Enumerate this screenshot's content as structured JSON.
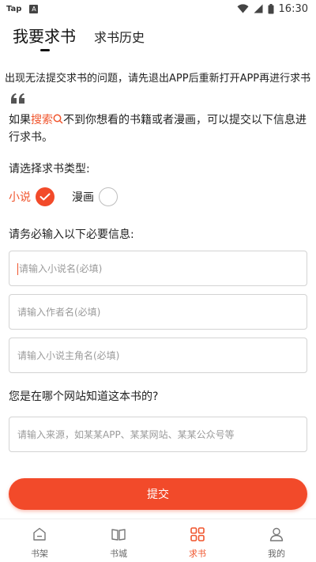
{
  "status_bar": {
    "app_label": "Tap",
    "notif_letter": "A",
    "time": "16:30",
    "icons": [
      "wifi-icon",
      "signal-icon",
      "battery-icon"
    ]
  },
  "header": {
    "tabs": [
      {
        "label": "我要求书",
        "active": true
      },
      {
        "label": "求书历史",
        "active": false
      }
    ]
  },
  "notice": {
    "text": "出现无法提交求书的问题，请先退出APP后重新打开APP再进行求书"
  },
  "hint": {
    "prefix": "如果",
    "search_label": "搜索",
    "suffix": "不到你想看的书籍或者漫画，可以提交以下信息进行求书。"
  },
  "type_section": {
    "label": "请选择求书类型:",
    "options": [
      {
        "label": "小说",
        "selected": true
      },
      {
        "label": "漫画",
        "selected": false
      }
    ]
  },
  "required_section": {
    "label": "请务必输入以下必要信息:",
    "fields": [
      {
        "placeholder": "请输入小说名(必填)",
        "value": ""
      },
      {
        "placeholder": "请输入作者名(必填)",
        "value": ""
      },
      {
        "placeholder": "请输入小说主角名(必填)",
        "value": ""
      }
    ]
  },
  "source_section": {
    "label": "您是在哪个网站知道这本书的?",
    "placeholder": "请输入来源，如某某APP、某某网站、某某公众号等",
    "value": ""
  },
  "submit_label": "提交",
  "bottom_nav": {
    "items": [
      {
        "label": "书架",
        "icon": "bookshelf-icon",
        "active": false
      },
      {
        "label": "书城",
        "icon": "book-open-icon",
        "active": false
      },
      {
        "label": "求书",
        "icon": "grid-icon",
        "active": true
      },
      {
        "label": "我的",
        "icon": "user-icon",
        "active": false
      }
    ]
  },
  "colors": {
    "accent": "#f24a2a",
    "text": "#222222",
    "border": "#d3d3d3",
    "placeholder": "#9a9a9a"
  }
}
